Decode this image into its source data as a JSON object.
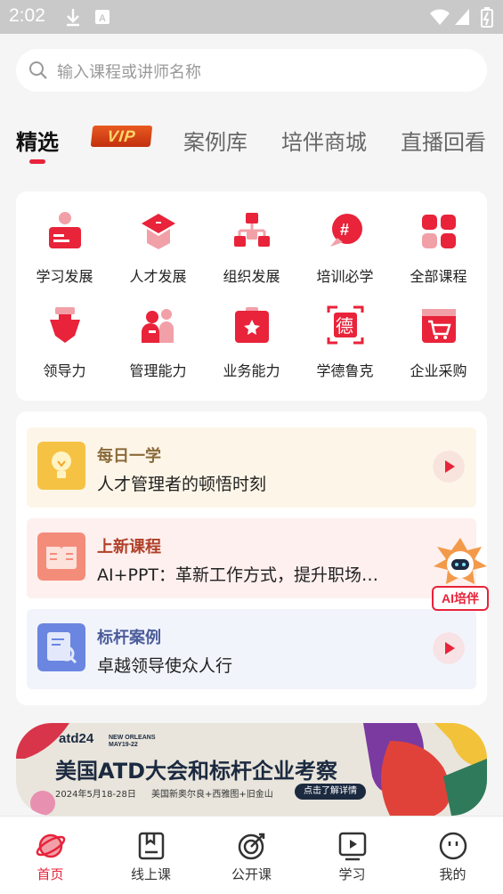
{
  "status_bar": {
    "time": "2:02"
  },
  "search": {
    "placeholder": "输入课程或讲师名称"
  },
  "tabs": [
    {
      "label": "精选",
      "active": true
    },
    {
      "label": "VIP",
      "badge": true
    },
    {
      "label": "案例库"
    },
    {
      "label": "培伴商城"
    },
    {
      "label": "直播回看"
    }
  ],
  "categories": [
    {
      "label": "学习发展",
      "icon": "learning-development-icon"
    },
    {
      "label": "人才发展",
      "icon": "graduation-cap-icon"
    },
    {
      "label": "组织发展",
      "icon": "org-chart-icon"
    },
    {
      "label": "培训必学",
      "icon": "hashtag-chat-icon"
    },
    {
      "label": "全部课程",
      "icon": "grid-squares-icon"
    },
    {
      "label": "领导力",
      "icon": "leadership-icon"
    },
    {
      "label": "管理能力",
      "icon": "management-people-icon"
    },
    {
      "label": "业务能力",
      "icon": "business-clipboard-icon"
    },
    {
      "label": "学德鲁克",
      "icon": "de-character-icon"
    },
    {
      "label": "企业采购",
      "icon": "shopping-cart-icon"
    }
  ],
  "feed": [
    {
      "title": "每日一学",
      "subtitle": "人才管理者的顿悟时刻",
      "icon": "lightbulb-icon",
      "title_color": "#8a6a3a"
    },
    {
      "title": "上新课程",
      "subtitle": "AI+PPT：革新工作方式，提升职场…",
      "icon": "open-book-icon",
      "title_color": "#b0402a"
    },
    {
      "title": "标杆案例",
      "subtitle": "卓越领导使众人行",
      "icon": "document-search-icon",
      "title_color": "#4a5c9a"
    }
  ],
  "ai_assistant": {
    "label": "AI培伴"
  },
  "banner": {
    "logo": "atd24",
    "location_line1": "NEW ORLEANS",
    "location_line2": "MAY19-22",
    "headline": "美国ATD大会和标杆企业考察",
    "date": "2024年5月18-28日",
    "places": "美国新奥尔良+西雅图+旧金山",
    "cta": "点击了解详情"
  },
  "bottom_nav": [
    {
      "label": "首页",
      "icon": "planet-home-icon",
      "active": true
    },
    {
      "label": "线上课",
      "icon": "bookmark-book-icon"
    },
    {
      "label": "公开课",
      "icon": "target-icon"
    },
    {
      "label": "学习",
      "icon": "video-play-icon"
    },
    {
      "label": "我的",
      "icon": "face-icon"
    }
  ],
  "colors": {
    "brand_red": "#e8233a",
    "background": "#f5f5f5"
  }
}
